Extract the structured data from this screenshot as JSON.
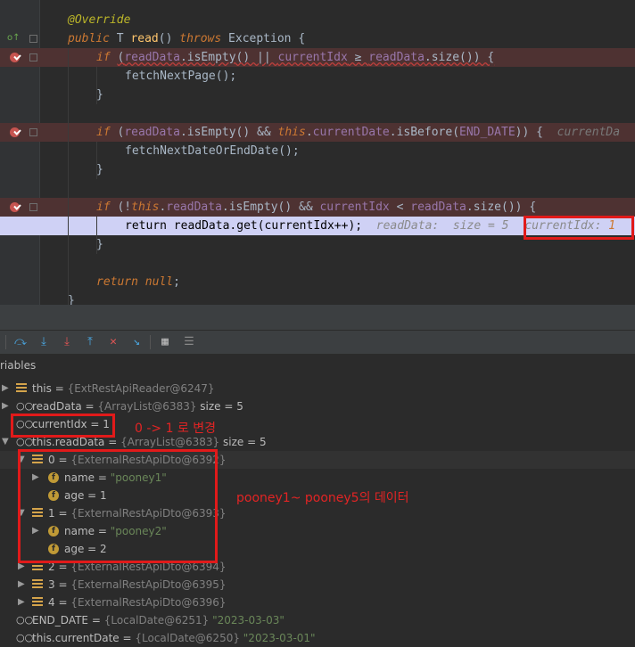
{
  "editor": {
    "lines": [
      {
        "tokens": [
          {
            "t": "@Override",
            "c": "ann"
          }
        ]
      },
      {
        "tokens": [
          {
            "t": "public ",
            "c": "kw"
          },
          {
            "t": "T ",
            "c": "fn"
          },
          {
            "t": "read",
            "c": "mth"
          },
          {
            "t": "() ",
            "c": "fn"
          },
          {
            "t": "throws ",
            "c": "kw"
          },
          {
            "t": "Exception {",
            "c": "fn"
          }
        ]
      },
      {
        "tokens": [
          {
            "t": "if ",
            "c": "kw"
          },
          {
            "t": "(",
            "c": "fn"
          },
          {
            "t": "readData",
            "c": "fld"
          },
          {
            "t": ".isEmpty() || ",
            "c": "fn"
          },
          {
            "t": "currentIdx",
            "c": "fld"
          },
          {
            "t": " ≥ ",
            "c": "fn"
          },
          {
            "t": "readData",
            "c": "fld"
          },
          {
            "t": ".size()) {",
            "c": "fn"
          }
        ]
      },
      {
        "tokens": [
          {
            "t": "fetchNextPage",
            "c": "fn"
          },
          {
            "t": "();",
            "c": "fn"
          }
        ]
      },
      {
        "tokens": [
          {
            "t": "}",
            "c": "fn"
          }
        ]
      },
      {
        "tokens": [
          {
            "t": "if ",
            "c": "kw"
          },
          {
            "t": "(",
            "c": "fn"
          },
          {
            "t": "readData",
            "c": "fld"
          },
          {
            "t": ".isEmpty() && ",
            "c": "fn"
          },
          {
            "t": "this",
            "c": "kw"
          },
          {
            "t": ".",
            "c": "fn"
          },
          {
            "t": "currentDate",
            "c": "fld"
          },
          {
            "t": ".isBefore(",
            "c": "fn"
          },
          {
            "t": "END_DATE",
            "c": "fld"
          },
          {
            "t": ")) {  ",
            "c": "fn"
          },
          {
            "t": "currentDa",
            "c": "inl"
          }
        ]
      },
      {
        "tokens": [
          {
            "t": "fetchNextDateOrEndDate",
            "c": "fn"
          },
          {
            "t": "();",
            "c": "fn"
          }
        ]
      },
      {
        "tokens": [
          {
            "t": "}",
            "c": "fn"
          }
        ]
      },
      {
        "tokens": [
          {
            "t": "if ",
            "c": "kw"
          },
          {
            "t": "(!",
            "c": "fn"
          },
          {
            "t": "this",
            "c": "kw"
          },
          {
            "t": ".",
            "c": "fn"
          },
          {
            "t": "readData",
            "c": "fld"
          },
          {
            "t": ".isEmpty() && ",
            "c": "fn"
          },
          {
            "t": "currentIdx",
            "c": "fld"
          },
          {
            "t": " < ",
            "c": "fn"
          },
          {
            "t": "readData",
            "c": "fld"
          },
          {
            "t": ".size()) {",
            "c": "fn"
          }
        ]
      },
      {
        "tokens": [
          {
            "t": "return ",
            "c": "dark"
          },
          {
            "t": "readData.get(currentIdx++);  ",
            "c": "dark"
          },
          {
            "t": "readData:  size = 5 ",
            "c": "hint"
          }
        ]
      },
      {
        "tokens": [
          {
            "t": "}",
            "c": "fn"
          }
        ]
      },
      {
        "tokens": [
          {
            "t": "return ",
            "c": "kw"
          },
          {
            "t": "null",
            "c": "kw"
          },
          {
            "t": ";",
            "c": "fn"
          }
        ]
      },
      {
        "tokens": [
          {
            "t": "}",
            "c": "fn"
          }
        ]
      }
    ],
    "inline_hint_label": "currentIdx: ",
    "inline_hint_value": "1"
  },
  "debug": {
    "variables_title": "riables",
    "toolbar_icons": [
      "step-over-icon",
      "step-into-icon",
      "force-step-into-icon",
      "step-out-icon",
      "drop-frame-icon",
      "run-to-cursor-icon",
      "evaluate-icon",
      "trace-icon"
    ]
  },
  "variables": [
    {
      "name": "this",
      "eq": " = ",
      "val": "{ExtRestApiReader@6247}",
      "extra": "",
      "icon": "list",
      "arrow": "▶",
      "indent": 0
    },
    {
      "name": "readData",
      "eq": " = ",
      "val": "{ArrayList@6383}",
      "extra": "  size = 5",
      "icon": "glasses",
      "arrow": "▶",
      "indent": 0
    },
    {
      "name": "currentIdx",
      "eq": " = ",
      "val": "1",
      "extra": "",
      "icon": "glasses",
      "arrow": "",
      "indent": 0
    },
    {
      "name": "this.readData",
      "eq": " = ",
      "val": "{ArrayList@6383}",
      "extra": "  size = 5",
      "icon": "glasses",
      "arrow": "▼",
      "indent": 0
    },
    {
      "name": "0",
      "eq": " = ",
      "val": "{ExternalRestApiDto@6392}",
      "extra": "",
      "icon": "list",
      "arrow": "▼",
      "indent": 1
    },
    {
      "name": "name",
      "eq": " = ",
      "val": "\"pooney1\"",
      "extra": "",
      "icon": "f",
      "arrow": "▶",
      "indent": 2,
      "str": true
    },
    {
      "name": "age",
      "eq": " = ",
      "val": "1",
      "extra": "",
      "icon": "f",
      "arrow": "",
      "indent": 2,
      "num": true
    },
    {
      "name": "1",
      "eq": " = ",
      "val": "{ExternalRestApiDto@6393}",
      "extra": "",
      "icon": "list",
      "arrow": "▼",
      "indent": 1
    },
    {
      "name": "name",
      "eq": " = ",
      "val": "\"pooney2\"",
      "extra": "",
      "icon": "f",
      "arrow": "▶",
      "indent": 2,
      "str": true
    },
    {
      "name": "age",
      "eq": " = ",
      "val": "2",
      "extra": "",
      "icon": "f",
      "arrow": "",
      "indent": 2,
      "num": true
    },
    {
      "name": "2",
      "eq": " = ",
      "val": "{ExternalRestApiDto@6394}",
      "extra": "",
      "icon": "list",
      "arrow": "▶",
      "indent": 1
    },
    {
      "name": "3",
      "eq": " = ",
      "val": "{ExternalRestApiDto@6395}",
      "extra": "",
      "icon": "list",
      "arrow": "▶",
      "indent": 1
    },
    {
      "name": "4",
      "eq": " = ",
      "val": "{ExternalRestApiDto@6396}",
      "extra": "",
      "icon": "list",
      "arrow": "▶",
      "indent": 1
    },
    {
      "name": "END_DATE",
      "eq": " = ",
      "val": "{LocalDate@6251}",
      "extra": " \"2023-03-03\"",
      "icon": "glasses",
      "arrow": "",
      "indent": 0,
      "extrastr": true
    },
    {
      "name": "this.currentDate",
      "eq": " = ",
      "val": "{LocalDate@6250}",
      "extra": " \"2023-03-01\"",
      "icon": "glasses",
      "arrow": "",
      "indent": 0,
      "extrastr": true
    }
  ],
  "annotations": {
    "idx_change": "0 -> 1 로 변경",
    "data_note": "pooney1~ pooney5의 데이터"
  }
}
